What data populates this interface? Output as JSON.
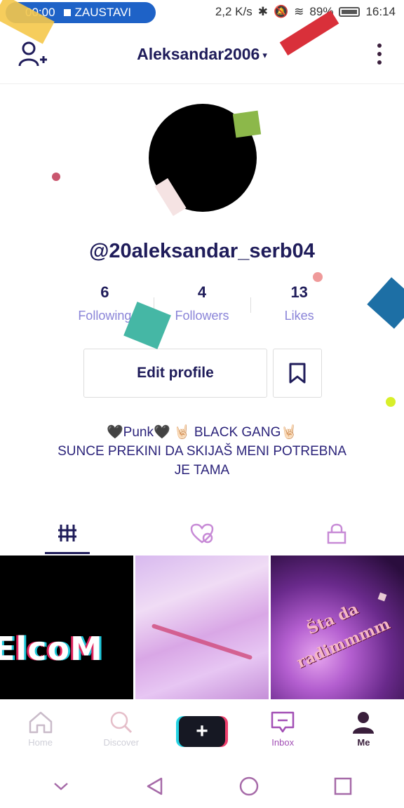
{
  "status_bar": {
    "recording_time": "00:00",
    "stop_label": "ZAUSTAVI",
    "speed": "2,2 K/s",
    "battery": "89%",
    "clock": "16:14"
  },
  "header": {
    "username": "Aleksandar2006",
    "caret": "▾"
  },
  "profile": {
    "handle": "@20aleksandar_serb04",
    "stats": [
      {
        "value": "6",
        "label": "Following"
      },
      {
        "value": "4",
        "label": "Followers"
      },
      {
        "value": "13",
        "label": "Likes"
      }
    ],
    "edit_label": "Edit profile",
    "bio_line1": "🖤Punk🖤 🤘🏻 BLACK GANG🤘🏻",
    "bio_line2": "SUNCE PREKINI DA SKIJAŠ MENI POTREBNA",
    "bio_line3": "JE TAMA"
  },
  "tabs": [
    {
      "icon": "grid-icon",
      "active": true
    },
    {
      "icon": "liked-hidden-icon",
      "active": false
    },
    {
      "icon": "lock-icon",
      "active": false
    }
  ],
  "videos": [
    {
      "caption": "ElcoM"
    },
    {
      "caption": ""
    },
    {
      "caption_line1": "Šta da",
      "caption_line2": "radimmmm"
    }
  ],
  "bottom_nav": {
    "home": "Home",
    "discover": "Discover",
    "create": "+",
    "inbox": "Inbox",
    "me": "Me"
  },
  "colors": {
    "title": "#1f1c5a",
    "stat_label": "#8a84d8",
    "accent_pink": "#a24fb5",
    "recording_pill": "#1e62c7"
  }
}
